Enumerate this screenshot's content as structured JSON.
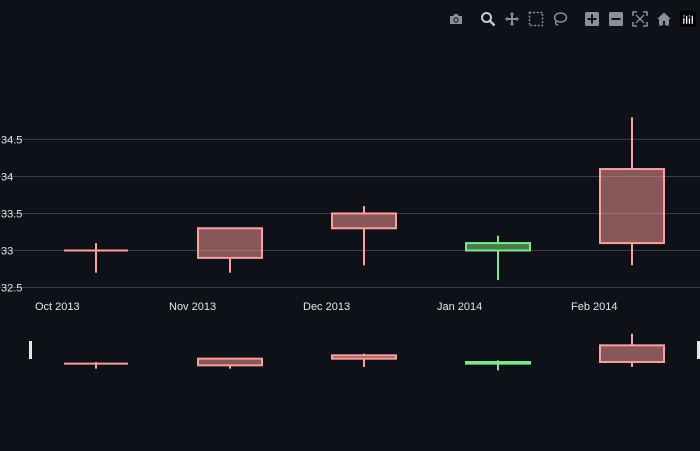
{
  "colors": {
    "background": "#0e1117",
    "increasing": "#ff9e9e",
    "decreasing": "#7ee787",
    "grid": "#3a3f4b",
    "text": "#e6e6e6",
    "modebar_icon": "#8c8f96",
    "modebar_active": "#c9ccd2"
  },
  "modebar": {
    "buttons": [
      {
        "name": "camera-icon",
        "title": "Download plot as a png"
      },
      {
        "name": "zoom-icon",
        "title": "Zoom"
      },
      {
        "name": "pan-icon",
        "title": "Pan"
      },
      {
        "name": "box-select-icon",
        "title": "Box Select"
      },
      {
        "name": "lasso-select-icon",
        "title": "Lasso Select"
      },
      {
        "name": "zoom-in-icon",
        "title": "Zoom in"
      },
      {
        "name": "zoom-out-icon",
        "title": "Zoom out"
      },
      {
        "name": "autoscale-icon",
        "title": "Autoscale"
      },
      {
        "name": "reset-axes-icon",
        "title": "Reset axes"
      },
      {
        "name": "plotly-logo-icon",
        "title": "Produced with Plotly"
      }
    ]
  },
  "chart_data": {
    "type": "candlestick",
    "x": [
      "2013-10",
      "2013-11",
      "2013-12",
      "2014-01",
      "2014-02"
    ],
    "x_tick_labels": [
      "Oct 2013",
      "Nov 2013",
      "Dec 2013",
      "Jan 2014",
      "Feb 2014"
    ],
    "open": [
      33.0,
      32.9,
      33.3,
      33.1,
      33.1
    ],
    "high": [
      33.1,
      33.3,
      33.6,
      33.2,
      34.8
    ],
    "low": [
      32.7,
      32.7,
      32.8,
      32.6,
      32.8
    ],
    "close": [
      33.0,
      33.3,
      33.5,
      33.0,
      34.1
    ],
    "y_ticks": [
      32.5,
      33,
      33.5,
      34,
      34.5
    ],
    "y_tick_labels": [
      "32.5",
      "33",
      "33.5",
      "34",
      "34.5"
    ],
    "ylim": [
      32.5,
      35.1
    ],
    "grid": true,
    "rangeslider": true,
    "title": "",
    "xlabel": "",
    "ylabel": ""
  }
}
